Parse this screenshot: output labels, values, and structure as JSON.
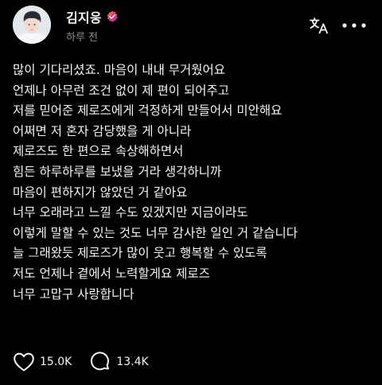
{
  "post": {
    "author": {
      "name": "김지웅",
      "verified": true,
      "avatar_icon": "profile-photo"
    },
    "timestamp": "하루 전",
    "header_icons": {
      "translate": "translate-icon",
      "more": "more-options-icon"
    },
    "lines": [
      "많이 기다리셨죠. 마음이 내내 무거웠어요",
      "언제나 아무런 조건 없이 제 편이 되어주고",
      "저를 믿어준 제로즈에게 걱정하게 만들어서 미안해요",
      "어쩌면 저 혼자 감당했을 게 아니라",
      "제로즈도 한 편으로 속상해하면서",
      "힘든 하루하루를 보냈을 거라 생각하니까",
      "마음이 편하지가 않았던 거 같아요",
      "너무 오래라고 느낄 수도 있겠지만 지금이라도",
      "이렇게 말할 수 있는 것도 너무 감사한 일인 거 같습니다",
      "늘 그래왔듯 제로즈가 많이 웃고 행복할 수 있도록",
      "저도 언제나 곁에서 노력할게요 제로즈",
      "너무 고맙구 사랑합니다"
    ],
    "actions": {
      "likes": "15.0K",
      "comments": "13.4K"
    }
  },
  "colors": {
    "background": "#000000",
    "text": "#f3f5f7",
    "muted": "#8a8d91",
    "verified": "#e1306c"
  }
}
